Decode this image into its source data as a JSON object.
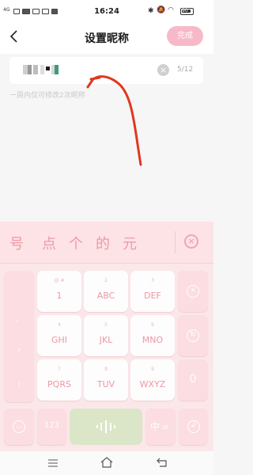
{
  "status_bar": {
    "time": "16:24",
    "left_indicators": [
      "4G",
      "HD",
      "5G"
    ],
    "battery": "90"
  },
  "header": {
    "title": "设置昵称",
    "done_label": "完成"
  },
  "nickname": {
    "char_count": "5/12",
    "hint": "一周内仅可修改2次昵称"
  },
  "keyboard": {
    "candidates": [
      "号",
      "点",
      "个",
      "的",
      "元"
    ],
    "left_column": [
      ",",
      "。",
      "?",
      "!"
    ],
    "keys": [
      {
        "sub": "@ #",
        "main": "1"
      },
      {
        "sub": "2",
        "main": "ABC"
      },
      {
        "sub": "3",
        "main": "DEF"
      },
      {
        "sub": "4",
        "main": "GHI"
      },
      {
        "sub": "5",
        "main": "JKL"
      },
      {
        "sub": "6",
        "main": "MNO"
      },
      {
        "sub": "7",
        "main": "PQRS"
      },
      {
        "sub": "8",
        "main": "TUV"
      },
      {
        "sub": "9",
        "main": "WXYZ"
      }
    ],
    "right_zero": "0",
    "bottom": {
      "num_label": "123",
      "lang_label": "中",
      "lang_sub": "/英"
    },
    "accent_color": "#ee97a5"
  }
}
